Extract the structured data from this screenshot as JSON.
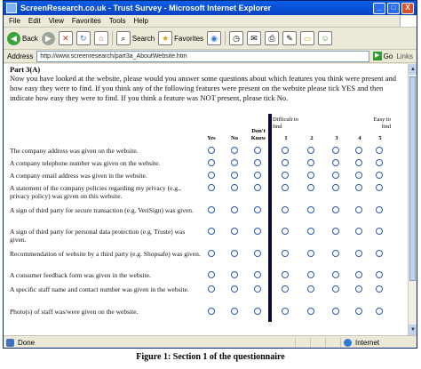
{
  "window": {
    "title": "ScreenResearch.co.uk - Trust Survey - Microsoft Internet Explorer",
    "controls": [
      "_",
      "□",
      "X"
    ]
  },
  "menu": [
    "File",
    "Edit",
    "View",
    "Favorites",
    "Tools",
    "Help"
  ],
  "toolbar": {
    "back_label": "Back",
    "search_label": "Search",
    "favorites_label": "Favorites"
  },
  "address": {
    "label": "Address",
    "value": "http://www.screenresearch/part3a_AboutWebsite.htm",
    "go_label": "Go",
    "links_label": "Links"
  },
  "page": {
    "part_title": "Part 3(A)",
    "intro": "Now you have looked at the website, please would you answer some questions about which features you think were present and how easy they were to find. If you think any of the following features were present on the website please tick YES and then indicate how easy they were to find. If you think a feature was NOT present, please tick No.",
    "headers": {
      "yes": "Yes",
      "no": "No",
      "dont_know": "Don't Know",
      "difficult": "Difficult to find",
      "easy": "Easy to find",
      "scale": [
        "1",
        "2",
        "3",
        "4",
        "5"
      ]
    },
    "questions": [
      "The company address was given on the website.",
      "A company telephone number was given on the website.",
      "A company email address was given in the website.",
      "A statement of the company policies regarding my privacy (e.g., privacy policy) was given on this website.",
      "A sign of third party for secure transaction (e.g. VeriSign) was given.",
      "A sign of third party for personal data protection (e.g. Truste) was given.",
      "Recommendation of website by a third party (e.g. Shopsafe) was given.",
      "A consumer feedback form was given in the website.",
      "A specific staff name and contact number was given in the website.",
      "Photo(s) of staff was/were given on the website."
    ]
  },
  "status": {
    "left": "Done",
    "zone": "Internet"
  },
  "caption": "Figure 1: Section 1 of the questionnaire"
}
